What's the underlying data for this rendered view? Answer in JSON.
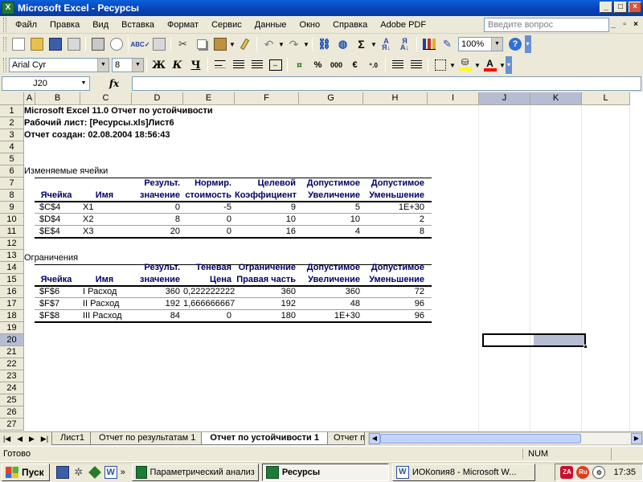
{
  "window": {
    "title": "Microsoft Excel - Ресурсы"
  },
  "menu": {
    "items": [
      "Файл",
      "Правка",
      "Вид",
      "Вставка",
      "Формат",
      "Сервис",
      "Данные",
      "Окно",
      "Справка",
      "Adobe PDF"
    ],
    "help_placeholder": "Введите вопрос"
  },
  "toolbar": {
    "zoom": "100%",
    "font_name": "Arial Cyr",
    "font_size": "8",
    "bold_label": "Ж",
    "italic_label": "К",
    "underline_label": "Ч",
    "percent_label": "%",
    "thousands_label": "000",
    "euro_label": "€",
    "fill_color": "#FFFF00",
    "font_color": "#FF0000",
    "icons": [
      "new-icon",
      "open-icon",
      "save-icon",
      "permission-icon",
      "print-icon",
      "print-preview-icon",
      "spelling-icon",
      "research-icon",
      "cut-icon",
      "copy-icon",
      "paste-icon",
      "format-painter-icon",
      "undo-icon",
      "redo-icon",
      "hyperlink-icon",
      "autosum-icon",
      "sort-ascending-icon",
      "sort-descending-icon",
      "chart-wizard-icon",
      "drawing-icon",
      "help-icon"
    ]
  },
  "formula_bar": {
    "name_box": "J20",
    "fx": "fx",
    "value": ""
  },
  "grid": {
    "columns": [
      "A",
      "B",
      "C",
      "D",
      "E",
      "F",
      "G",
      "H",
      "I",
      "J",
      "K",
      "L"
    ],
    "rows": [
      "1",
      "2",
      "3",
      "4",
      "5",
      "6",
      "7",
      "8",
      "9",
      "10",
      "11",
      "12",
      "13",
      "14",
      "15",
      "16",
      "17",
      "18",
      "19",
      "20",
      "21",
      "22",
      "23",
      "24",
      "25",
      "26",
      "27"
    ],
    "selected_cell": "J20"
  },
  "report": {
    "title": "Microsoft Excel 11.0 Отчет по устойчивости",
    "worksheet": "Рабочий лист: [Ресурсы.xls]Лист6",
    "created": "Отчет создан: 02.08.2004 18:56:43",
    "adjustable_cells": {
      "title": "Изменяемые ячейки",
      "headers_top": [
        "",
        "",
        "Результ.",
        "Нормир.",
        "Целевой",
        "Допустимое",
        "Допустимое"
      ],
      "headers_bottom": [
        "Ячейка",
        "Имя",
        "значение",
        "стоимость",
        "Коэффициент",
        "Увеличение",
        "Уменьшение"
      ],
      "rows": [
        [
          "$C$4",
          "X1",
          "0",
          "-5",
          "9",
          "5",
          "1E+30"
        ],
        [
          "$D$4",
          "X2",
          "8",
          "0",
          "10",
          "10",
          "2"
        ],
        [
          "$E$4",
          "X3",
          "20",
          "0",
          "16",
          "4",
          "8"
        ]
      ]
    },
    "constraints": {
      "title": "Ограничения",
      "headers_top": [
        "",
        "",
        "Результ.",
        "Теневая",
        "Ограничение",
        "Допустимое",
        "Допустимое"
      ],
      "headers_bottom": [
        "Ячейка",
        "Имя",
        "значение",
        "Цена",
        "Правая часть",
        "Увеличение",
        "Уменьшение"
      ],
      "rows": [
        [
          "$F$6",
          "I Расход",
          "360",
          "0,222222222",
          "360",
          "360",
          "72"
        ],
        [
          "$F$7",
          "II Расход",
          "192",
          "1,666666667",
          "192",
          "48",
          "96"
        ],
        [
          "$F$8",
          "III Расход",
          "84",
          "0",
          "180",
          "1E+30",
          "96"
        ]
      ]
    }
  },
  "sheet_tabs": {
    "tabs": [
      "Лист1",
      "Отчет по результатам 1",
      "Отчет по устойчивости 1",
      "Отчет п"
    ],
    "active_index": 2
  },
  "status": {
    "ready": "Готово",
    "num": "NUM"
  },
  "taskbar": {
    "start": "Пуск",
    "buttons": [
      "Параметрический анализ",
      "Ресурсы",
      "ИОКопия8 - Microsoft W..."
    ],
    "active_index": 1,
    "clock": "17:35"
  }
}
